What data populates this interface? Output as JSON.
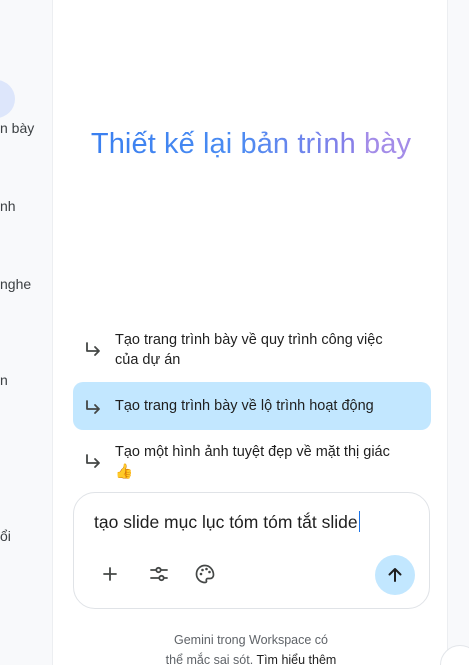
{
  "sidebar": {
    "items": [
      {
        "label": "n bày"
      },
      {
        "label": "nh"
      },
      {
        "label": "nghe"
      },
      {
        "label": "n"
      },
      {
        "label": "ổi"
      }
    ]
  },
  "headline": {
    "part1": "Thiết kế lại bản trình",
    "part2": "bày"
  },
  "suggestions": [
    {
      "line1": "Tạo trang trình bày về quy trình công việc",
      "line2": "của dự án"
    },
    {
      "line1": "Tạo trang trình bày về lộ trình hoạt động",
      "line2": ""
    },
    {
      "line1": "Tạo một hình ảnh tuyệt đẹp về mặt thị giác",
      "line2": "👍"
    }
  ],
  "composer": {
    "input_value": "tạo slide mục lục tóm tóm tắt slide",
    "tools": [
      "plus-icon",
      "tune-icon",
      "palette-icon"
    ],
    "send_icon": "arrow-up-icon"
  },
  "disclaimer": {
    "line1": "Gemini trong Workspace có",
    "line2_prefix": "thể mắc sai sót.",
    "link": "Tìm hiểu thêm"
  },
  "colors": {
    "accent": "#1a73e8",
    "highlight": "#c2e7ff",
    "headline_blue": "#3a7ff0",
    "headline_purple": "#a38ce8"
  }
}
